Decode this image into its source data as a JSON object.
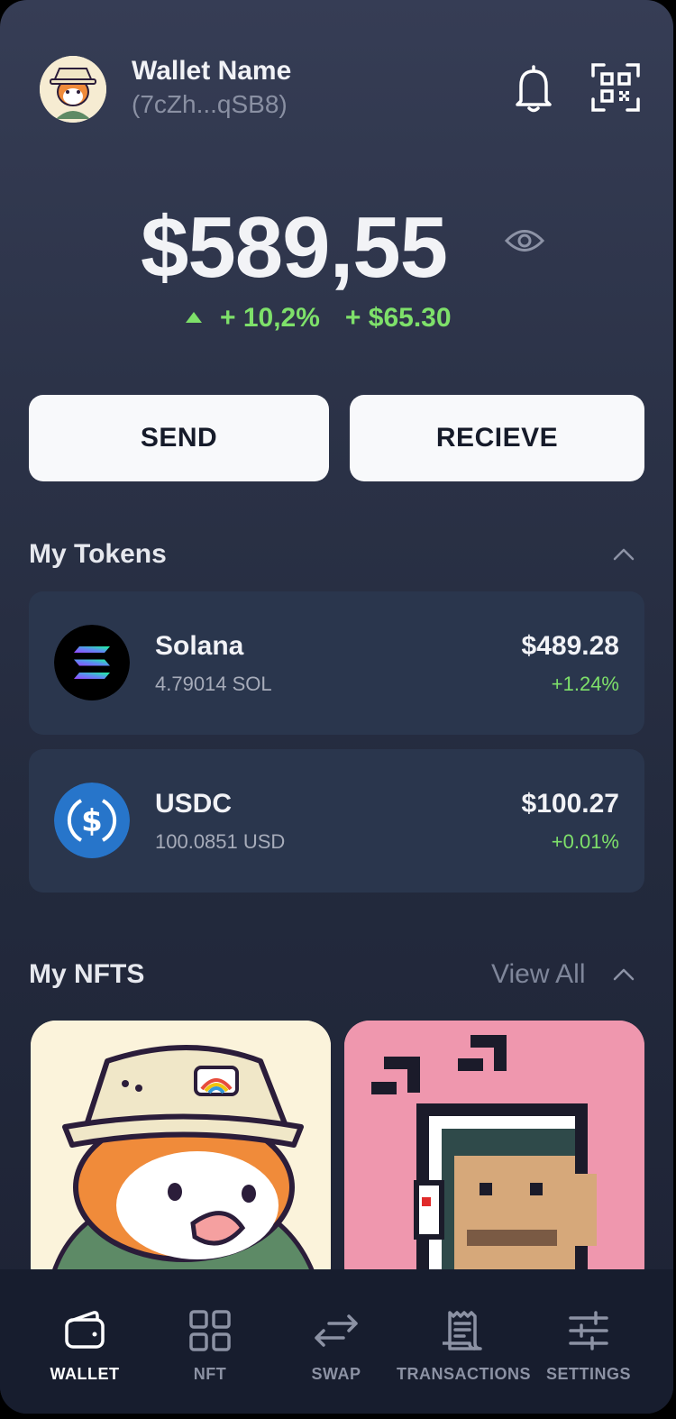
{
  "header": {
    "wallet_name": "Wallet Name",
    "wallet_address": "(7cZh...qSB8)",
    "icons": [
      "avatar",
      "bell-icon",
      "qr-code-icon"
    ]
  },
  "balance": {
    "amount": "$589,55",
    "change_percent": "+ 10,2%",
    "change_amount": "+ $65.30",
    "positive_color": "#7ee06a"
  },
  "actions": {
    "send_label": "SEND",
    "receive_label": "RECIEVE"
  },
  "tokens_section": {
    "title": "My Tokens",
    "items": [
      {
        "name": "Solana",
        "amount": "4.79014 SOL",
        "value": "$489.28",
        "change": "+1.24%",
        "icon": "solana-logo-icon"
      },
      {
        "name": "USDC",
        "amount": "100.0851 USD",
        "value": "$100.27",
        "change": "+0.01%",
        "icon": "usdc-logo-icon"
      }
    ]
  },
  "nfts_section": {
    "title": "My NFTS",
    "view_all_label": "View All",
    "items": [
      {
        "image": "fox-with-bucket-hat-nft",
        "background": "#fbf3db"
      },
      {
        "image": "pixel-character-headphones-nft",
        "background": "#ef97ae"
      }
    ]
  },
  "nav": {
    "items": [
      {
        "label": "WALLET",
        "icon": "wallet-icon",
        "active": true
      },
      {
        "label": "NFT",
        "icon": "grid-icon",
        "active": false
      },
      {
        "label": "SWAP",
        "icon": "swap-arrows-icon",
        "active": false
      },
      {
        "label": "TRANSACTIONS",
        "icon": "receipt-icon",
        "active": false
      },
      {
        "label": "SETTINGS",
        "icon": "sliders-icon",
        "active": false
      }
    ]
  }
}
